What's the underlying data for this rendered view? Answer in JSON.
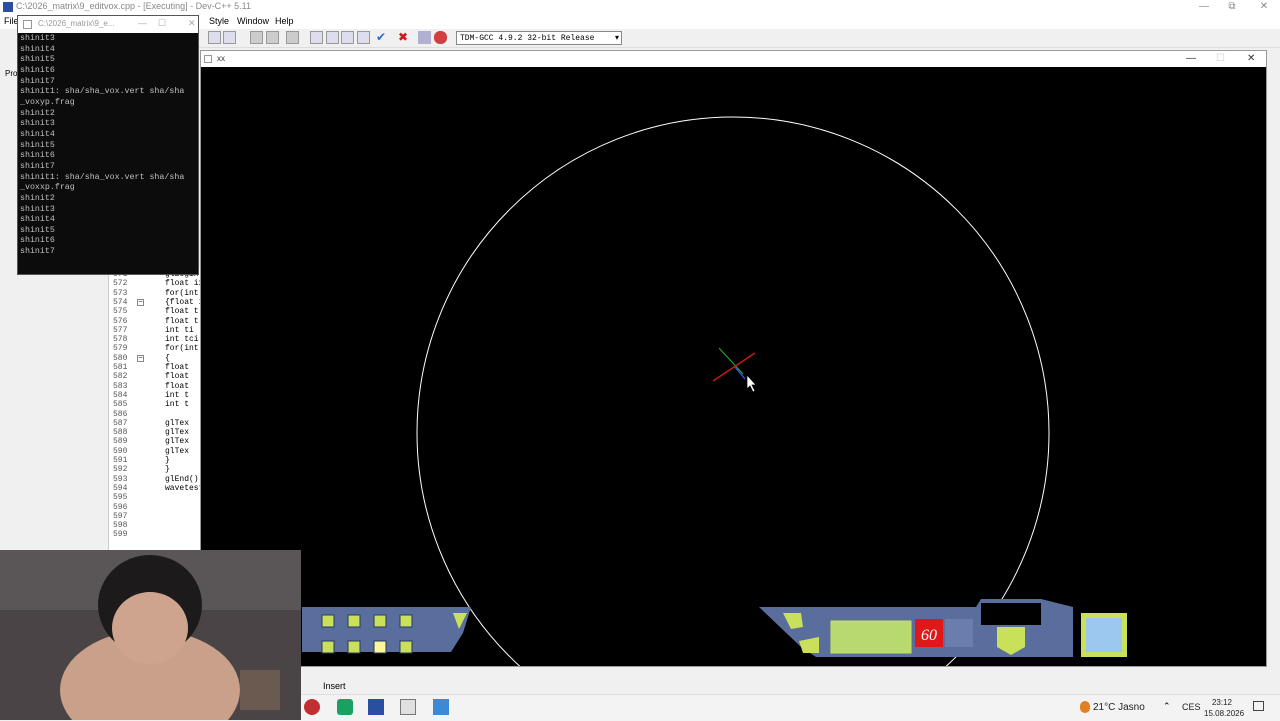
{
  "devcpp": {
    "title": "C:\\2026_matrix\\9_editvox.cpp - [Executing] - Dev-C++ 5.11",
    "menu": [
      "File",
      "Style",
      "Window",
      "Help"
    ],
    "compiler": "TDM-GCC 4.9.2 32-bit Release",
    "left_tab": "Proj"
  },
  "editor": {
    "lines": [
      {
        "n": "571",
        "code": "glBegin"
      },
      {
        "n": "572",
        "code": "float ix"
      },
      {
        "n": "573",
        "code": "for(int"
      },
      {
        "n": "574",
        "code": "{float i"
      },
      {
        "n": "575",
        "code": " float t"
      },
      {
        "n": "576",
        "code": " float t"
      },
      {
        "n": "577",
        "code": " int ti"
      },
      {
        "n": "578",
        "code": " int tci"
      },
      {
        "n": "579",
        "code": " for(int"
      },
      {
        "n": "580",
        "code": " {"
      },
      {
        "n": "581",
        "code": "  float"
      },
      {
        "n": "582",
        "code": "  float"
      },
      {
        "n": "583",
        "code": "  float"
      },
      {
        "n": "584",
        "code": "  int t"
      },
      {
        "n": "585",
        "code": "  int t"
      },
      {
        "n": "586",
        "code": ""
      },
      {
        "n": "587",
        "code": "  glTex"
      },
      {
        "n": "588",
        "code": "  glTex"
      },
      {
        "n": "589",
        "code": "  glTex"
      },
      {
        "n": "590",
        "code": "  glTex"
      },
      {
        "n": "591",
        "code": " }"
      },
      {
        "n": "592",
        "code": "}"
      },
      {
        "n": "593",
        "code": "glEnd();"
      },
      {
        "n": "594",
        "code": "wavetest"
      },
      {
        "n": "595",
        "code": ""
      },
      {
        "n": "596",
        "code": ""
      },
      {
        "n": "597",
        "code": ""
      },
      {
        "n": "598",
        "code": ""
      },
      {
        "n": "599",
        "code": ""
      }
    ]
  },
  "console": {
    "title": "C:\\2026_matrix\\9_e...",
    "lines": [
      "shinit3",
      "shinit4",
      "shinit5",
      "shinit6",
      "shinit7",
      "shinit1: sha/sha_vox.vert sha/sha",
      "_voxyp.frag",
      "shinit2",
      "shinit3",
      "shinit4",
      "shinit5",
      "shinit6",
      "shinit7",
      "shinit1: sha/sha_vox.vert sha/sha",
      "_voxxp.frag",
      "shinit2",
      "shinit3",
      "shinit4",
      "shinit5",
      "shinit6",
      "shinit7"
    ]
  },
  "game": {
    "title": "xx",
    "hud_counter": "60"
  },
  "status": {
    "mode": "Insert"
  },
  "taskbar": {
    "weather": "21°C  Jasno",
    "lang": "CES",
    "time": "23:12",
    "date": "15.08.2026"
  },
  "colors": {
    "hud_fill": "#5a6e9e",
    "hud_accent": "#c8e05a",
    "hud_red": "#e01818",
    "circle": "#ffffff"
  }
}
